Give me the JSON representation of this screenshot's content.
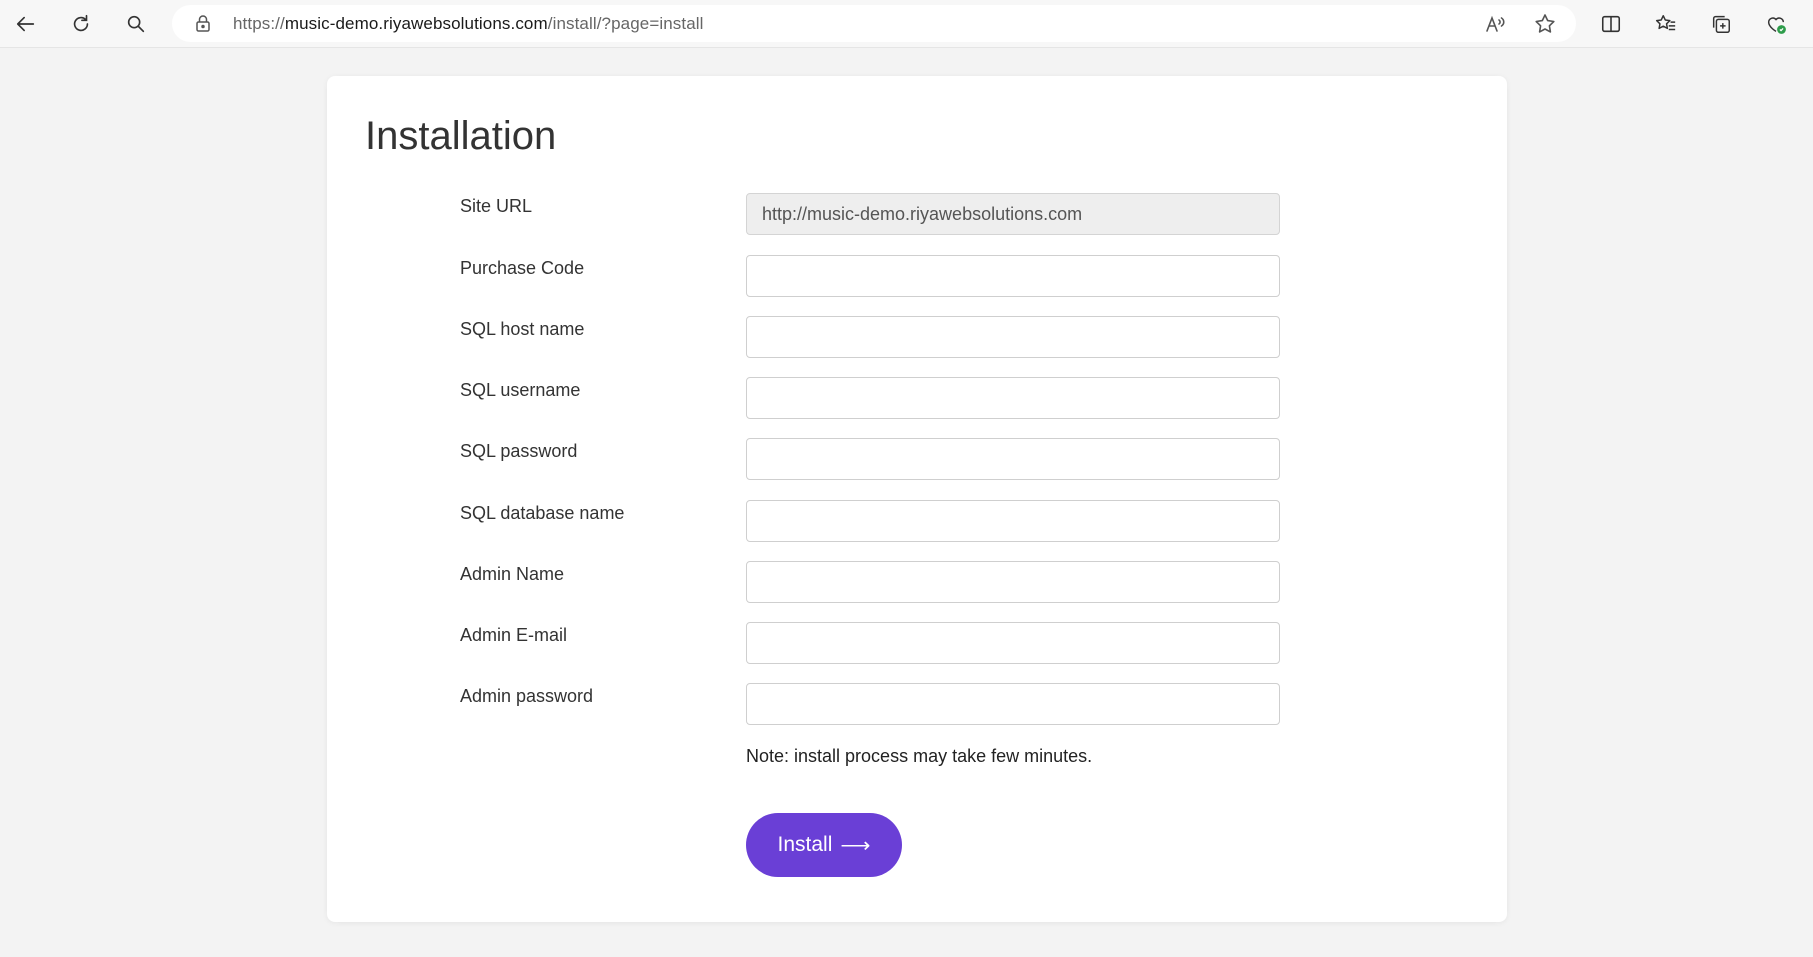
{
  "browser": {
    "url_prefix": "https://",
    "url_host": "music-demo.riyawebsolutions.com",
    "url_path": "/install/?page=install",
    "icons": [
      "back-icon",
      "refresh-icon",
      "search-icon",
      "lock-icon",
      "read-aloud-icon",
      "favorite-star-icon",
      "split-screen-icon",
      "favorites-icon",
      "collections-icon",
      "browser-essentials-icon"
    ]
  },
  "page": {
    "title": "Installation",
    "fields": [
      {
        "label": "Site URL",
        "value": "http://music-demo.riyawebsolutions.com"
      },
      {
        "label": "Purchase Code",
        "value": ""
      },
      {
        "label": "SQL host name",
        "value": ""
      },
      {
        "label": "SQL username",
        "value": ""
      },
      {
        "label": "SQL password",
        "value": ""
      },
      {
        "label": "SQL database name",
        "value": ""
      },
      {
        "label": "Admin Name",
        "value": ""
      },
      {
        "label": "Admin E-mail",
        "value": ""
      },
      {
        "label": "Admin password",
        "value": ""
      }
    ],
    "note": "Note: install process may take few minutes.",
    "install_label": "Install",
    "install_arrow": "⟶"
  },
  "colors": {
    "accent": "#6a3fd6",
    "page_bg": "#f3f3f3",
    "card_bg": "#ffffff"
  }
}
